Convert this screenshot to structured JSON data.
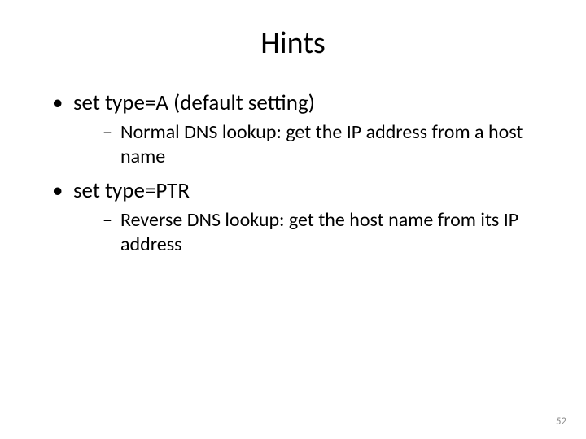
{
  "title": "Hints",
  "bullets": [
    {
      "text": "set type=A (default setting)",
      "sub": [
        "Normal DNS lookup: get the IP address from a host name"
      ]
    },
    {
      "text": "set type=PTR",
      "sub": [
        "Reverse DNS lookup: get the host name from its IP address"
      ]
    }
  ],
  "page_number": "52"
}
